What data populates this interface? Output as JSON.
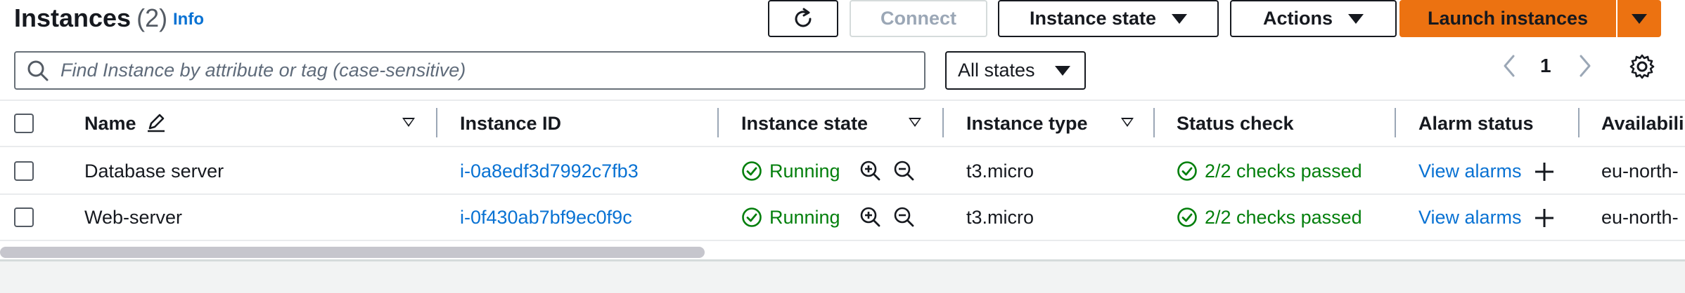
{
  "header": {
    "title": "Instances",
    "count": "(2)",
    "info_link": "Info",
    "refresh_icon": "refresh-icon",
    "connect_label": "Connect",
    "instance_state_label": "Instance state",
    "actions_label": "Actions",
    "launch_label": "Launch instances"
  },
  "search": {
    "placeholder": "Find Instance by attribute or tag (case-sensitive)",
    "value": ""
  },
  "state_filter": {
    "selected": "All states"
  },
  "pagination": {
    "current_page": "1"
  },
  "table": {
    "columns": [
      "Name",
      "Instance ID",
      "Instance state",
      "Instance type",
      "Status check",
      "Alarm status",
      "Availabili"
    ],
    "rows": [
      {
        "name": "Database server",
        "instance_id": "i-0a8edf3d7992c7fb3",
        "state": "Running",
        "type": "t3.micro",
        "status_check": "2/2 checks passed",
        "alarm": "View alarms",
        "az": "eu-north-"
      },
      {
        "name": "Web-server",
        "instance_id": "i-0f430ab7bf9ec0f9c",
        "state": "Running",
        "type": "t3.micro",
        "status_check": "2/2 checks passed",
        "alarm": "View alarms",
        "az": "eu-north-"
      }
    ]
  },
  "colors": {
    "primary": "#ec7211",
    "link": "#0972d3",
    "success": "#037f0c",
    "text": "#16191f",
    "disabled": "#9ba7b6"
  }
}
